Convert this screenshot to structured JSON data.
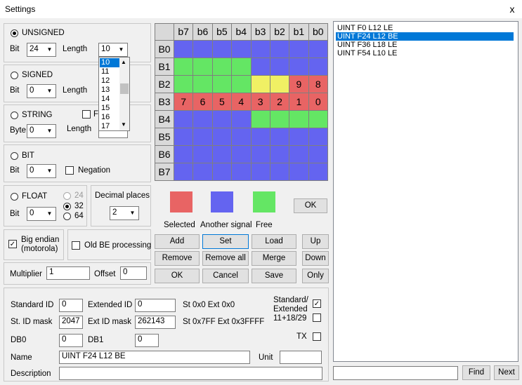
{
  "window": {
    "title": "Settings",
    "close": "x"
  },
  "unsigned": {
    "label": "UNSIGNED",
    "bit_label": "Bit",
    "bit_value": "24",
    "length_label": "Length",
    "length_value": "10"
  },
  "length_dropdown": {
    "options": [
      "10",
      "11",
      "12",
      "13",
      "14",
      "15",
      "16",
      "17"
    ],
    "selected_index": 0
  },
  "signed": {
    "label": "SIGNED",
    "bit_label": "Bit",
    "bit_value": "0",
    "length_label": "Length"
  },
  "string": {
    "label": "STRING",
    "byte_label": "Byte",
    "byte_value": "0",
    "length_label": "Length",
    "extra_label": "F"
  },
  "bit": {
    "label": "BIT",
    "bit_label": "Bit",
    "bit_value": "0",
    "negation_label": "Negation"
  },
  "float": {
    "label": "FLOAT",
    "bit_label": "Bit",
    "bit_value": "0",
    "opt24": "24",
    "opt32": "32",
    "opt64": "64"
  },
  "decimal": {
    "label": "Decimal places",
    "value": "2"
  },
  "big_endian": {
    "label_line1": "Big endian",
    "label_line2": "(motorola)"
  },
  "old_be": {
    "label": "Old BE processing"
  },
  "multiplier": {
    "label": "Multiplier",
    "value": "1",
    "offset_label": "Offset",
    "offset_value": "0"
  },
  "grid": {
    "col_headers": [
      "b7",
      "b6",
      "b5",
      "b4",
      "b3",
      "b2",
      "b1",
      "b0"
    ],
    "row_headers": [
      "B0",
      "B1",
      "B2",
      "B3",
      "B4",
      "B5",
      "B6",
      "B7"
    ],
    "colors": [
      "#6464f0",
      "#64e664",
      "#f0f064",
      "#e86464"
    ],
    "cells": [
      [
        0,
        0,
        0,
        0,
        0,
        0,
        0,
        0
      ],
      [
        1,
        1,
        1,
        1,
        0,
        0,
        0,
        0
      ],
      [
        1,
        1,
        1,
        1,
        2,
        2,
        3,
        3
      ],
      [
        3,
        3,
        3,
        3,
        3,
        3,
        3,
        3
      ],
      [
        0,
        0,
        0,
        0,
        1,
        1,
        1,
        1
      ],
      [
        0,
        0,
        0,
        0,
        0,
        0,
        0,
        0
      ],
      [
        0,
        0,
        0,
        0,
        0,
        0,
        0,
        0
      ],
      [
        0,
        0,
        0,
        0,
        0,
        0,
        0,
        0
      ]
    ],
    "labels": [
      [
        "",
        "",
        "",
        "",
        "",
        "",
        "",
        ""
      ],
      [
        "",
        "",
        "",
        "",
        "",
        "",
        "",
        ""
      ],
      [
        "",
        "",
        "",
        "",
        "",
        "",
        "9",
        "8"
      ],
      [
        "7",
        "6",
        "5",
        "4",
        "3",
        "2",
        "1",
        "0"
      ],
      [
        "",
        "",
        "",
        "",
        "",
        "",
        "",
        ""
      ],
      [
        "",
        "",
        "",
        "",
        "",
        "",
        "",
        ""
      ],
      [
        "",
        "",
        "",
        "",
        "",
        "",
        "",
        ""
      ],
      [
        "",
        "",
        "",
        "",
        "",
        "",
        "",
        ""
      ]
    ]
  },
  "legend": {
    "selected": "Selected",
    "another": "Another signal",
    "free": "Free",
    "selected_color": "#e86464",
    "another_color": "#6464f0",
    "free_color": "#64e664"
  },
  "ok_small": "OK",
  "buttons": {
    "add": "Add",
    "set": "Set",
    "load": "Load",
    "up": "Up",
    "remove": "Remove",
    "remove_all": "Remove all",
    "merge": "Merge",
    "down": "Down",
    "ok": "OK",
    "cancel": "Cancel",
    "save": "Save",
    "only": "Only"
  },
  "signals": {
    "items": [
      "UINT F0 L12 LE",
      "UINT F24 L12 BE",
      "UINT F36 L18 LE",
      "UINT F54 L10 LE"
    ],
    "selected_index": 1
  },
  "search": {
    "value": "",
    "find": "Find",
    "next": "Next"
  },
  "ids": {
    "std_id_label": "Standard ID",
    "std_id_value": "0",
    "ext_id_label": "Extended ID",
    "ext_id_value": "0",
    "st_ext_text": "St 0x0 Ext 0x0",
    "std_mask_label": "St. ID mask",
    "std_mask_value": "2047",
    "ext_mask_label": "Ext ID mask",
    "ext_mask_value": "262143",
    "mask_text": "St 0x7FF Ext 0x3FFFF",
    "std_ext_label1": "Standard/",
    "std_ext_label2": "Extended",
    "std_ext_label3": "11+18/29",
    "db0_label": "DB0",
    "db0_value": "0",
    "db1_label": "DB1",
    "db1_value": "0",
    "tx_label": "TX",
    "name_label": "Name",
    "name_value": "UINT F24 L12 BE",
    "unit_label": "Unit",
    "unit_value": "",
    "desc_label": "Description",
    "desc_value": ""
  }
}
